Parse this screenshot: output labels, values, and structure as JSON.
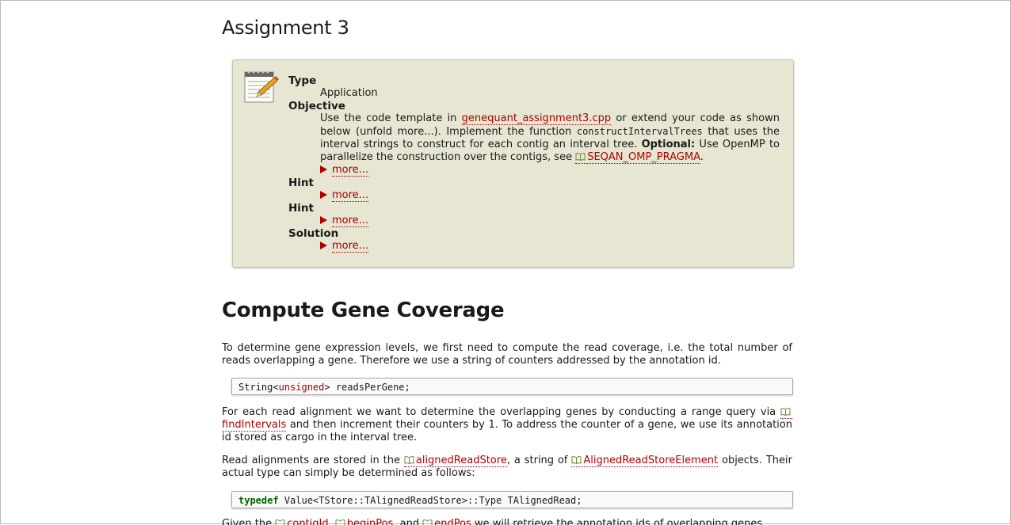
{
  "assignment": {
    "title": "Assignment 3",
    "type_label": "Type",
    "type_value": "Application",
    "objective_label": "Objective",
    "objective": {
      "t1": "Use the code template in ",
      "file_link": "genequant_assignment3.cpp",
      "t2": " or extend your code as shown below (unfold more...). Implement the function ",
      "func": "constructIntervalTrees",
      "t3": " that uses the interval strings to construct for each contig an interval tree. ",
      "optional": "Optional:",
      "t4": " Use OpenMP to parallelize the construction over the contigs, see ",
      "macro_link": "SEQAN_OMP_PRAGMA",
      "t5": "."
    },
    "more_label": "more...",
    "hint_label": "Hint",
    "solution_label": "Solution"
  },
  "section": {
    "title": "Compute Gene Coverage",
    "p1": "To determine gene expression levels, we first need to compute the read coverage, i.e. the total number of reads overlapping a gene. Therefore we use a string of counters addressed by the annotation id.",
    "code1": {
      "a": "String<",
      "kw": "unsigned",
      "b": "> readsPerGene;"
    },
    "p2": {
      "t1": "For each read alignment we want to determine the overlapping genes by conducting a range query via ",
      "link": "findIntervals",
      "t2": " and then increment their counters by 1. To address the counter of a gene, we use its annotation id stored as cargo in the interval tree."
    },
    "p3": {
      "t1": "Read alignments are stored in the ",
      "link1": "alignedReadStore",
      "t2": ", a string of ",
      "link2": "AlignedReadStoreElement",
      "t3": " objects. Their actual type can simply be determined as follows:"
    },
    "code2": {
      "kw": "typedef",
      "rest": " Value<TStore::TAlignedReadStore>::Type TAlignedRead;"
    },
    "p4": {
      "t1": "Given the ",
      "link1": "contigId",
      "t2": ", ",
      "link2": "beginPos",
      "t3": ", and ",
      "link3": "endPos",
      "t4": " we will retrieve the annotation ids of overlapping genes"
    }
  }
}
